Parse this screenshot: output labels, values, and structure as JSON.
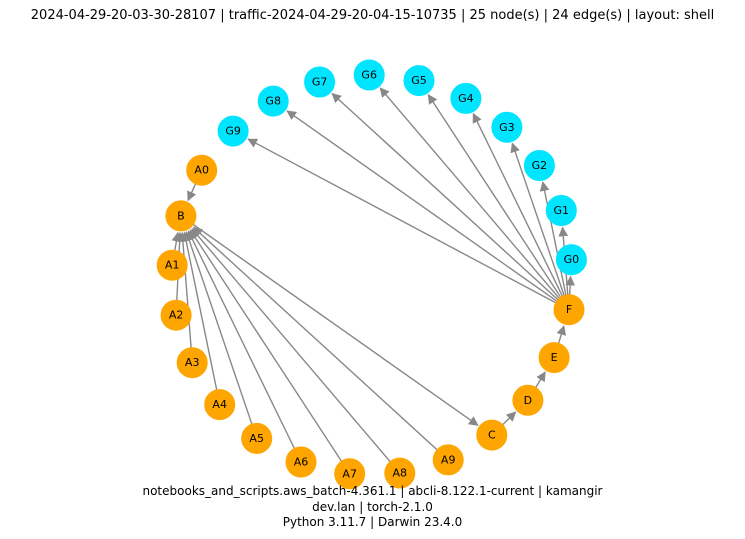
{
  "header": {
    "title_parts": [
      "2024-04-29-20-03-30-28107",
      "traffic-2024-04-29-20-04-15-10735",
      "25 node(s)",
      "24 edge(s)",
      "layout: shell"
    ]
  },
  "footer": {
    "line1_parts": [
      "notebooks_and_scripts.aws_batch-4.361.1",
      "abcli-8.122.1-current",
      "kamangir"
    ],
    "line2_parts": [
      "dev.lan",
      "torch-2.1.0"
    ],
    "line3_parts": [
      "Python 3.11.7",
      "Darwin 23.4.0"
    ]
  },
  "chart_data": {
    "type": "graph",
    "layout": "shell",
    "node_count": 25,
    "edge_count": 24,
    "colors": {
      "orange": "#ffa500",
      "cyan": "#00e5ff",
      "edge": "#888888"
    },
    "nodes": [
      {
        "id": "G0",
        "group": "cyan"
      },
      {
        "id": "G1",
        "group": "cyan"
      },
      {
        "id": "G2",
        "group": "cyan"
      },
      {
        "id": "G3",
        "group": "cyan"
      },
      {
        "id": "G4",
        "group": "cyan"
      },
      {
        "id": "G5",
        "group": "cyan"
      },
      {
        "id": "G6",
        "group": "cyan"
      },
      {
        "id": "G7",
        "group": "cyan"
      },
      {
        "id": "G8",
        "group": "cyan"
      },
      {
        "id": "G9",
        "group": "cyan"
      },
      {
        "id": "A0",
        "group": "orange"
      },
      {
        "id": "B",
        "group": "orange"
      },
      {
        "id": "A1",
        "group": "orange"
      },
      {
        "id": "A2",
        "group": "orange"
      },
      {
        "id": "A3",
        "group": "orange"
      },
      {
        "id": "A4",
        "group": "orange"
      },
      {
        "id": "A5",
        "group": "orange"
      },
      {
        "id": "A6",
        "group": "orange"
      },
      {
        "id": "A7",
        "group": "orange"
      },
      {
        "id": "A8",
        "group": "orange"
      },
      {
        "id": "A9",
        "group": "orange"
      },
      {
        "id": "C",
        "group": "orange"
      },
      {
        "id": "D",
        "group": "orange"
      },
      {
        "id": "E",
        "group": "orange"
      },
      {
        "id": "F",
        "group": "orange"
      }
    ],
    "edges": [
      {
        "from": "A0",
        "to": "B"
      },
      {
        "from": "A1",
        "to": "B"
      },
      {
        "from": "A2",
        "to": "B"
      },
      {
        "from": "A3",
        "to": "B"
      },
      {
        "from": "A4",
        "to": "B"
      },
      {
        "from": "A5",
        "to": "B"
      },
      {
        "from": "A6",
        "to": "B"
      },
      {
        "from": "A7",
        "to": "B"
      },
      {
        "from": "A8",
        "to": "B"
      },
      {
        "from": "A9",
        "to": "B"
      },
      {
        "from": "B",
        "to": "C"
      },
      {
        "from": "C",
        "to": "D"
      },
      {
        "from": "D",
        "to": "E"
      },
      {
        "from": "E",
        "to": "F"
      },
      {
        "from": "F",
        "to": "G0"
      },
      {
        "from": "F",
        "to": "G1"
      },
      {
        "from": "F",
        "to": "G2"
      },
      {
        "from": "F",
        "to": "G3"
      },
      {
        "from": "F",
        "to": "G4"
      },
      {
        "from": "F",
        "to": "G5"
      },
      {
        "from": "F",
        "to": "G6"
      },
      {
        "from": "F",
        "to": "G7"
      },
      {
        "from": "F",
        "to": "G8"
      },
      {
        "from": "F",
        "to": "G9"
      }
    ]
  }
}
